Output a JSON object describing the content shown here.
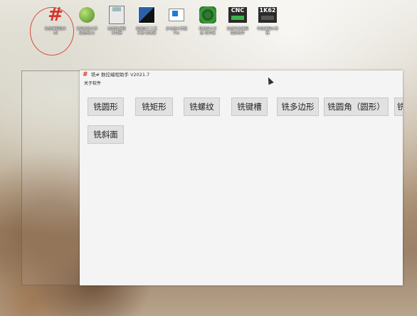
{
  "desktop": {
    "icons": [
      {
        "label": "数控编程助手\nv8",
        "icon": "hash-icon"
      },
      {
        "label": "刀具参数计算\n及选用(1)",
        "icon": "apple-icon"
      },
      {
        "label": "数控车编程\n计算器",
        "icon": "calculator-icon"
      },
      {
        "label": "机械加工工艺\n手册 标准版",
        "icon": "cube-icon"
      },
      {
        "label": "多功能计算器\nPro",
        "icon": "window-icon"
      },
      {
        "label": "机械设计手\n册 软件版",
        "icon": "gear-icon"
      },
      {
        "label": "数控车床编程\n模拟软件",
        "icon": "cnc-tile-icon",
        "tile_text": "CNC"
      },
      {
        "label": "车削编程计算\n器",
        "icon": "1k62-tile-icon",
        "tile_text": "1K62"
      }
    ]
  },
  "app": {
    "title_icon": "#",
    "title": "铣# 数控编程助手 V2021.7",
    "menu": [
      "关于软件"
    ],
    "buttons": [
      "铣圆形",
      "铣矩形",
      "铣螺纹",
      "铣键槽",
      "铣多边形",
      "铣圆角（圆形）",
      "铣倒角",
      "铣斜面"
    ]
  },
  "colors": {
    "accent_red": "#d8342c",
    "button_bg": "#e1e1e1",
    "window_bg": "#f4f4f4"
  }
}
